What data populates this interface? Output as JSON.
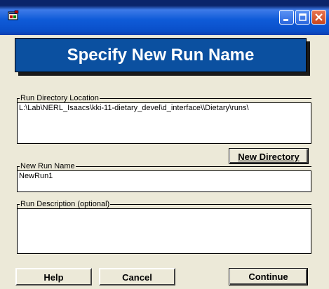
{
  "window": {
    "background_text": "",
    "colors": {
      "titlebar": "#0f5bd8",
      "dialog_bg": "#ece9d8",
      "banner": "#0b50a0",
      "close_button": "#d9532b"
    }
  },
  "banner": {
    "title": "Specify New Run Name"
  },
  "run_directory": {
    "label": "Run Directory Location",
    "value": "L:\\Lab\\NERL_Isaacs\\kki-11-dietary_devel\\d_interface\\\\Dietary\\runs\\"
  },
  "new_directory_button": {
    "label": "New Directory"
  },
  "new_run_name": {
    "label": "New Run Name",
    "value": "NewRun1"
  },
  "run_description": {
    "label": "Run Description (optional)",
    "value": ""
  },
  "buttons": {
    "help": "Help",
    "cancel": "Cancel",
    "continue": "Continue"
  },
  "icons": [
    "app-icon",
    "minimize-icon",
    "maximize-icon",
    "close-icon"
  ]
}
